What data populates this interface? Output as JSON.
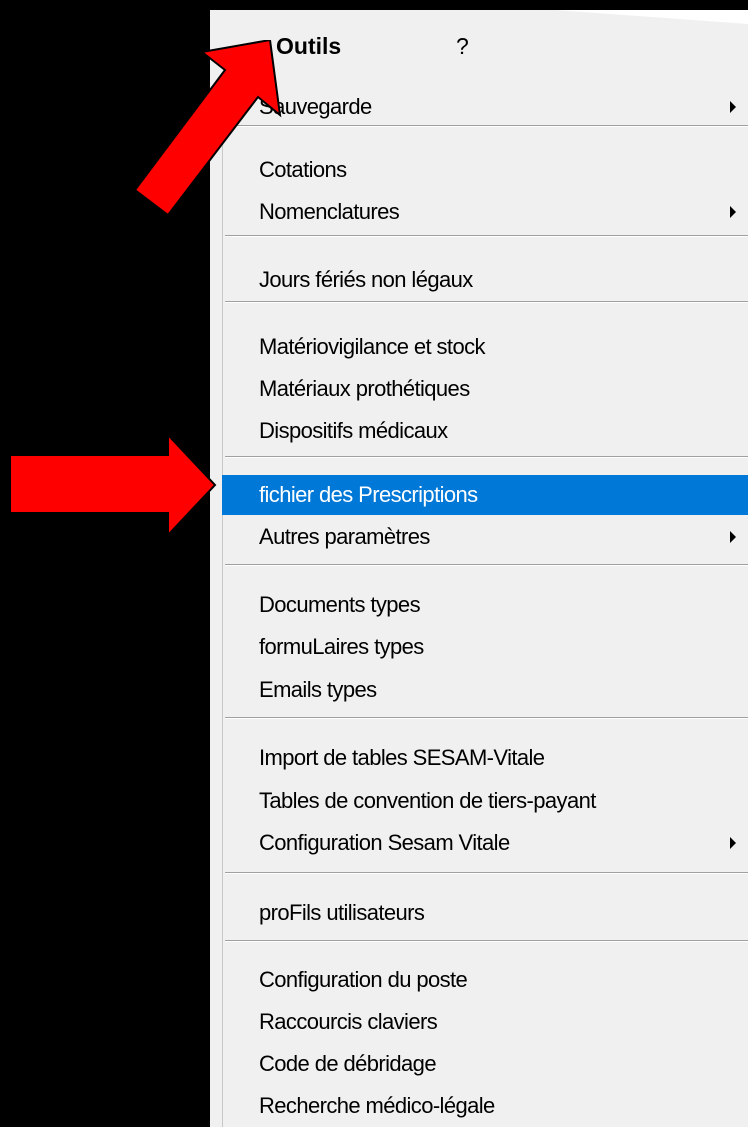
{
  "menubar": {
    "outils": "Outils",
    "help": "?"
  },
  "menu": {
    "sauvegarde": "Sauvegarde",
    "cotations": "Cotations",
    "nomenclatures": "Nomenclatures",
    "jours_feries": "Jours fériés non légaux",
    "materiovigilance": "Matériovigilance et stock",
    "materiaux": "Matériaux prothétiques",
    "dispositifs": "Dispositifs médicaux",
    "prescriptions": "fichier des Prescriptions",
    "autres": "Autres paramètres",
    "documents": "Documents types",
    "formulaires": "formuLaires types",
    "emails": "Emails types",
    "import_sesam": "Import de tables SESAM-Vitale",
    "tables_convention": "Tables de convention de tiers-payant",
    "config_sesam": "Configuration Sesam Vitale",
    "profils": "proFils utilisateurs",
    "config_poste": "Configuration du poste",
    "raccourcis": "Raccourcis claviers",
    "debridage": "Code de débridage",
    "recherche": "Recherche médico-légale"
  },
  "colors": {
    "highlight": "#0078d7",
    "arrow": "#ff0000"
  }
}
